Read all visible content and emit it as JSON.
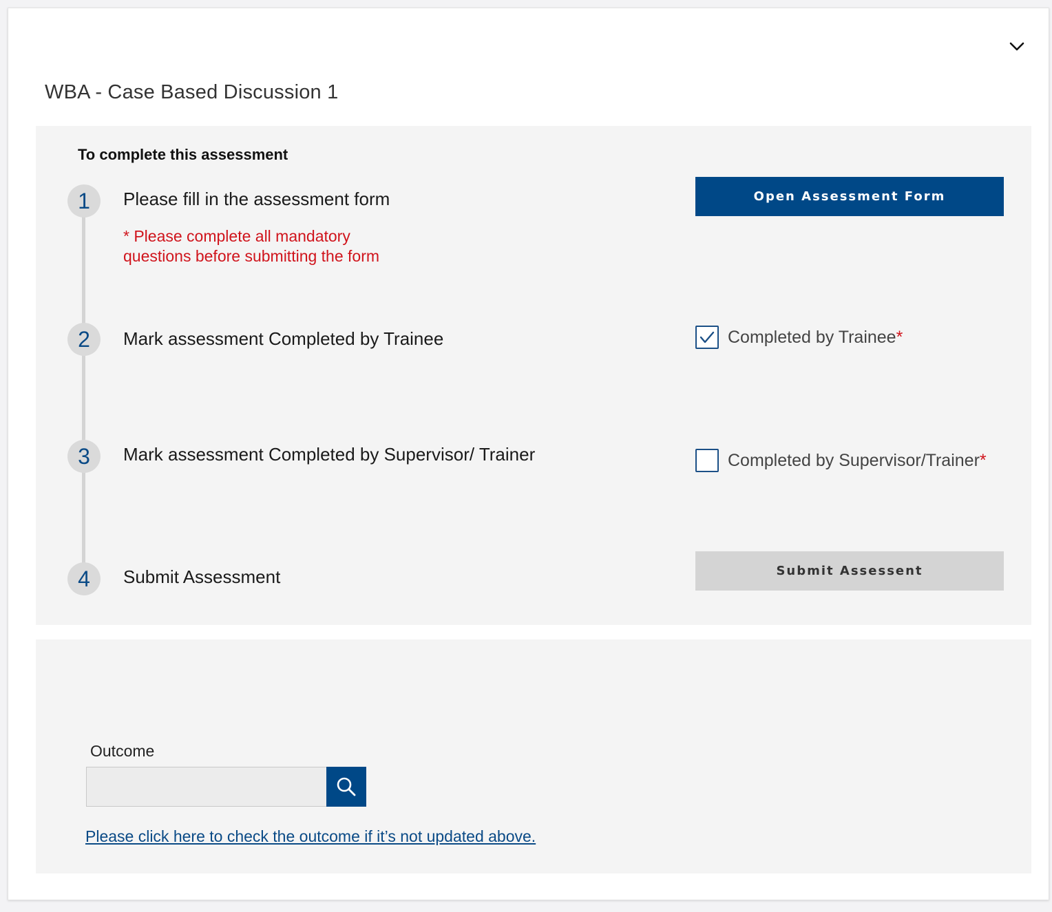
{
  "header": {
    "title": "WBA - Case Based Discussion 1"
  },
  "steps_panel": {
    "heading": "To complete this assessment",
    "steps": [
      {
        "number": "1",
        "label": "Please fill in the assessment form"
      },
      {
        "number": "2",
        "label": "Mark assessment Completed by Trainee"
      },
      {
        "number": "3",
        "label": "Mark assessment Completed by Supervisor/ Trainer"
      },
      {
        "number": "4",
        "label": "Submit Assessment"
      }
    ],
    "warning": "* Please complete all mandatory questions before submitting the form",
    "open_form_button": "Open Assessment Form",
    "trainee_checkbox": {
      "label": "Completed by Trainee",
      "required_mark": "*",
      "checked": true
    },
    "supervisor_checkbox": {
      "label": "Completed by Supervisor/Trainer",
      "required_mark": "*",
      "checked": false
    },
    "submit_button": "Submit Assessent"
  },
  "outcome_panel": {
    "label": "Outcome",
    "input_value": "",
    "link_text": "Please click here to check the outcome if it’s not updated above."
  },
  "colors": {
    "primary": "#004887",
    "required": "#d0141c",
    "panel_bg": "#f4f4f4"
  },
  "icons": {
    "collapse": "chevron-down-icon",
    "search": "search-icon",
    "checkmark": "checkmark-icon"
  }
}
